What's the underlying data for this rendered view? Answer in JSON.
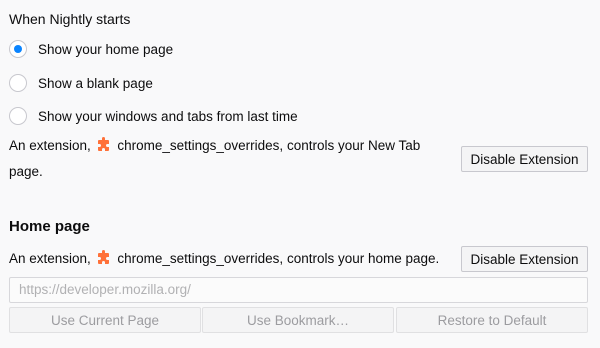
{
  "startup": {
    "heading": "When Nightly starts",
    "options": [
      {
        "label": "Show your home page",
        "selected": true
      },
      {
        "label": "Show a blank page",
        "selected": false
      },
      {
        "label": "Show your windows and tabs from last time",
        "selected": false
      }
    ],
    "extension_notice": {
      "prefix": "An extension,",
      "extension_name": "chrome_settings_overrides,",
      "suffix_line1": "controls your New Tab",
      "suffix_line2": "page.",
      "icon": "puzzle-extension-icon"
    },
    "disable_button_label": "Disable Extension"
  },
  "home_page": {
    "title": "Home page",
    "extension_notice": {
      "prefix": "An extension,",
      "extension_name": "chrome_settings_overrides,",
      "suffix": "controls your home page.",
      "icon": "puzzle-extension-icon"
    },
    "disable_button_label": "Disable Extension",
    "url_value": "https://developer.mozilla.org/",
    "buttons": {
      "use_current": "Use Current Page",
      "use_bookmark": "Use Bookmark…",
      "restore_default": "Restore to Default"
    }
  },
  "colors": {
    "accent": "#0a84ff",
    "extension_icon": "#ff7139"
  }
}
